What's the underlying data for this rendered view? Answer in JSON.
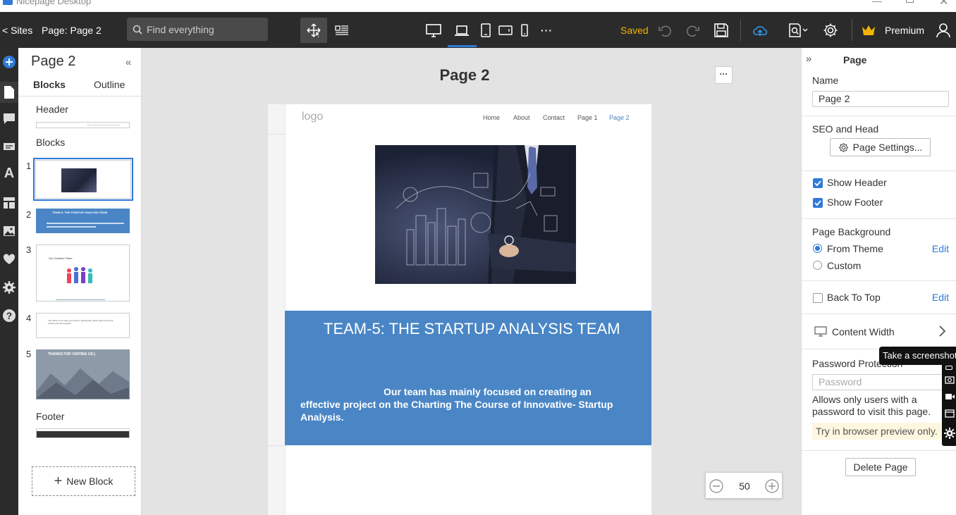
{
  "window": {
    "title": "Nicepage Desktop"
  },
  "toolbar": {
    "sites_label": "< Sites",
    "page_label": "Page: Page 2",
    "search_placeholder": "Find everything",
    "saved_label": "Saved",
    "premium_label": "Premium",
    "more_label": "···",
    "accent_color": "#f0b400"
  },
  "left_panel": {
    "title": "Page 2",
    "tabs": [
      {
        "label": "Blocks",
        "active": true
      },
      {
        "label": "Outline",
        "active": false
      }
    ],
    "header_label": "Header",
    "blocks_label": "Blocks",
    "blocks": [
      {
        "num": "1",
        "text": ""
      },
      {
        "num": "2",
        "text": "TEAM-5: THE STARTUP ANALYSIS TEAM"
      },
      {
        "num": "3",
        "text": "Our Creative Team"
      },
      {
        "num": "4",
        "text": "The value of our team you know in partnership, which gives our entire service and this program."
      },
      {
        "num": "5",
        "text": "THANKS FOR VISITING US:)"
      }
    ],
    "footer_label": "Footer",
    "new_block_label": "New Block"
  },
  "canvas": {
    "page_title": "Page 2",
    "more_label": "···",
    "site": {
      "logo": "logo",
      "nav": [
        "Home",
        "About",
        "Contact",
        "Page 1",
        "Page 2"
      ],
      "active_nav": "Page 2",
      "headline": "TEAM-5: THE STARTUP ANALYSIS TEAM",
      "body_line1": "Our team has mainly focused on creating an",
      "body_line2": "effective project on the Charting The Course of Innovative- Startup",
      "body_line3": "Analysis.",
      "brand_color": "#4a86c5"
    },
    "zoom": "50"
  },
  "right_panel": {
    "title": "Page",
    "name_label": "Name",
    "name_value": "Page 2",
    "seo_label": "SEO and Head",
    "page_settings_label": "Page Settings...",
    "show_header_label": "Show Header",
    "show_header_checked": true,
    "show_footer_label": "Show Footer",
    "show_footer_checked": true,
    "page_bg_label": "Page Background",
    "from_theme_label": "From Theme",
    "custom_label": "Custom",
    "edit_label": "Edit",
    "back_to_top_label": "Back To Top",
    "content_width_label": "Content Width",
    "password_protection_label": "Password Protection",
    "password_placeholder": "Password",
    "password_note": "Allows only users with a password to visit this page.",
    "browser_preview_note": "Try in browser preview only.",
    "delete_page_label": "Delete Page"
  },
  "tooltip": {
    "text": "Take a screenshot"
  }
}
